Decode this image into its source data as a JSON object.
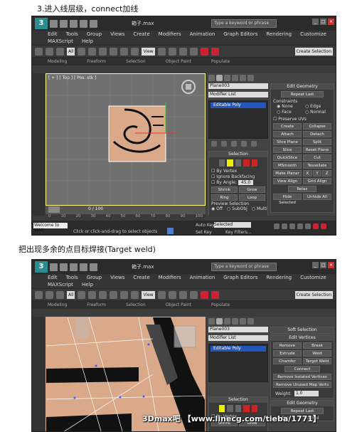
{
  "step3": {
    "caption": "3.进入线层级，connect加线"
  },
  "step4": {
    "caption": "把出现多余的点目标焊接(Target weld)"
  },
  "app": {
    "window_title": "箱子.max",
    "search_placeholder": "Type a keyword or phrase",
    "menu": [
      "Edit",
      "Tools",
      "Group",
      "Views",
      "Create",
      "Modifiers",
      "Animation",
      "Graph Editors",
      "Rendering",
      "Customize"
    ],
    "menu_row2": [
      "MAXScript",
      "Help"
    ],
    "toolbar_filter": "All",
    "toolbar_view": "View",
    "selection_set": "Create Selection",
    "ribbon_tabs": [
      "Modeling",
      "Freeform",
      "Selection",
      "Object Paint",
      "Populate"
    ]
  },
  "shot1": {
    "viewport_label": "[ + ] [ Top ] [ Pos. stk ]",
    "object_name": "Plane003",
    "modifier_list": "Modifier List",
    "stack_item": "Editable Poly",
    "edit_geometry": {
      "title": "Edit Geometry",
      "repeat_last": "Repeat Last",
      "constraints": "Constraints",
      "options": [
        "None",
        "Edge",
        "Face",
        "Normal"
      ],
      "preserve_uvs": "Preserve UVs",
      "buttons": [
        "Create",
        "Collapse",
        "Attach",
        "Detach",
        "Slice Plane",
        "Split",
        "Slice",
        "Reset Plane",
        "QuickSlice",
        "Cut",
        "MSmooth",
        "Tessellate",
        "Make Planar",
        "X",
        "Y",
        "Z",
        "View Align",
        "Grid Align",
        "Relax",
        "Hide Selected",
        "Unhide All"
      ]
    },
    "selection": {
      "title": "Selection",
      "options": [
        "By Vertex",
        "Ignore Backfacing",
        "By Angle:"
      ],
      "angle_value": "45.0",
      "buttons": [
        "Shrink",
        "Grow",
        "Ring",
        "Loop"
      ],
      "preview": "Preview Selection",
      "preview_options": [
        "Off",
        "SubObj",
        "Multi"
      ]
    },
    "timeline": "0 / 100",
    "timeline_ticks": [
      "0",
      "10",
      "20",
      "30",
      "40",
      "50",
      "60",
      "70",
      "80",
      "90",
      "100"
    ],
    "status_left": "Welcome to MAX",
    "status_hint": "Click or click-and-drag to select objects",
    "auto_key": "Auto Key",
    "set_key": "Set Key",
    "selected": "Selected",
    "key_filters": "Key Filters..."
  },
  "shot2": {
    "object_name": "Plane003",
    "modifier_list": "Modifier List",
    "stack_item": "Editable Poly",
    "soft_selection": "Soft Selection",
    "edit_vertices": {
      "title": "Edit Vertices",
      "buttons": [
        "Remove",
        "Break",
        "Extrude",
        "Weld",
        "Chamfer",
        "Target Weld",
        "Connect",
        "Remove Isolated Vertices",
        "Remove Unused Map Verts"
      ],
      "weight_label": "Weight:",
      "weight_value": "1.0"
    },
    "edit_geometry": {
      "title": "Edit Geometry",
      "repeat_last": "Repeat Last",
      "options": [
        "Face",
        "Normal"
      ]
    },
    "selection": {
      "title": "Selection",
      "by_vertex": "By Vertex",
      "buttons": [
        "Shrink",
        "Grow"
      ]
    }
  },
  "watermark": "3Dmax吧 【www.linecg.com/tieba/1771】",
  "colors": {
    "viewport_bg": "#707070",
    "poly_fill": "#d9a98a",
    "stack_blue": "#2457b8",
    "highlight_yellow": "#ffee00"
  }
}
